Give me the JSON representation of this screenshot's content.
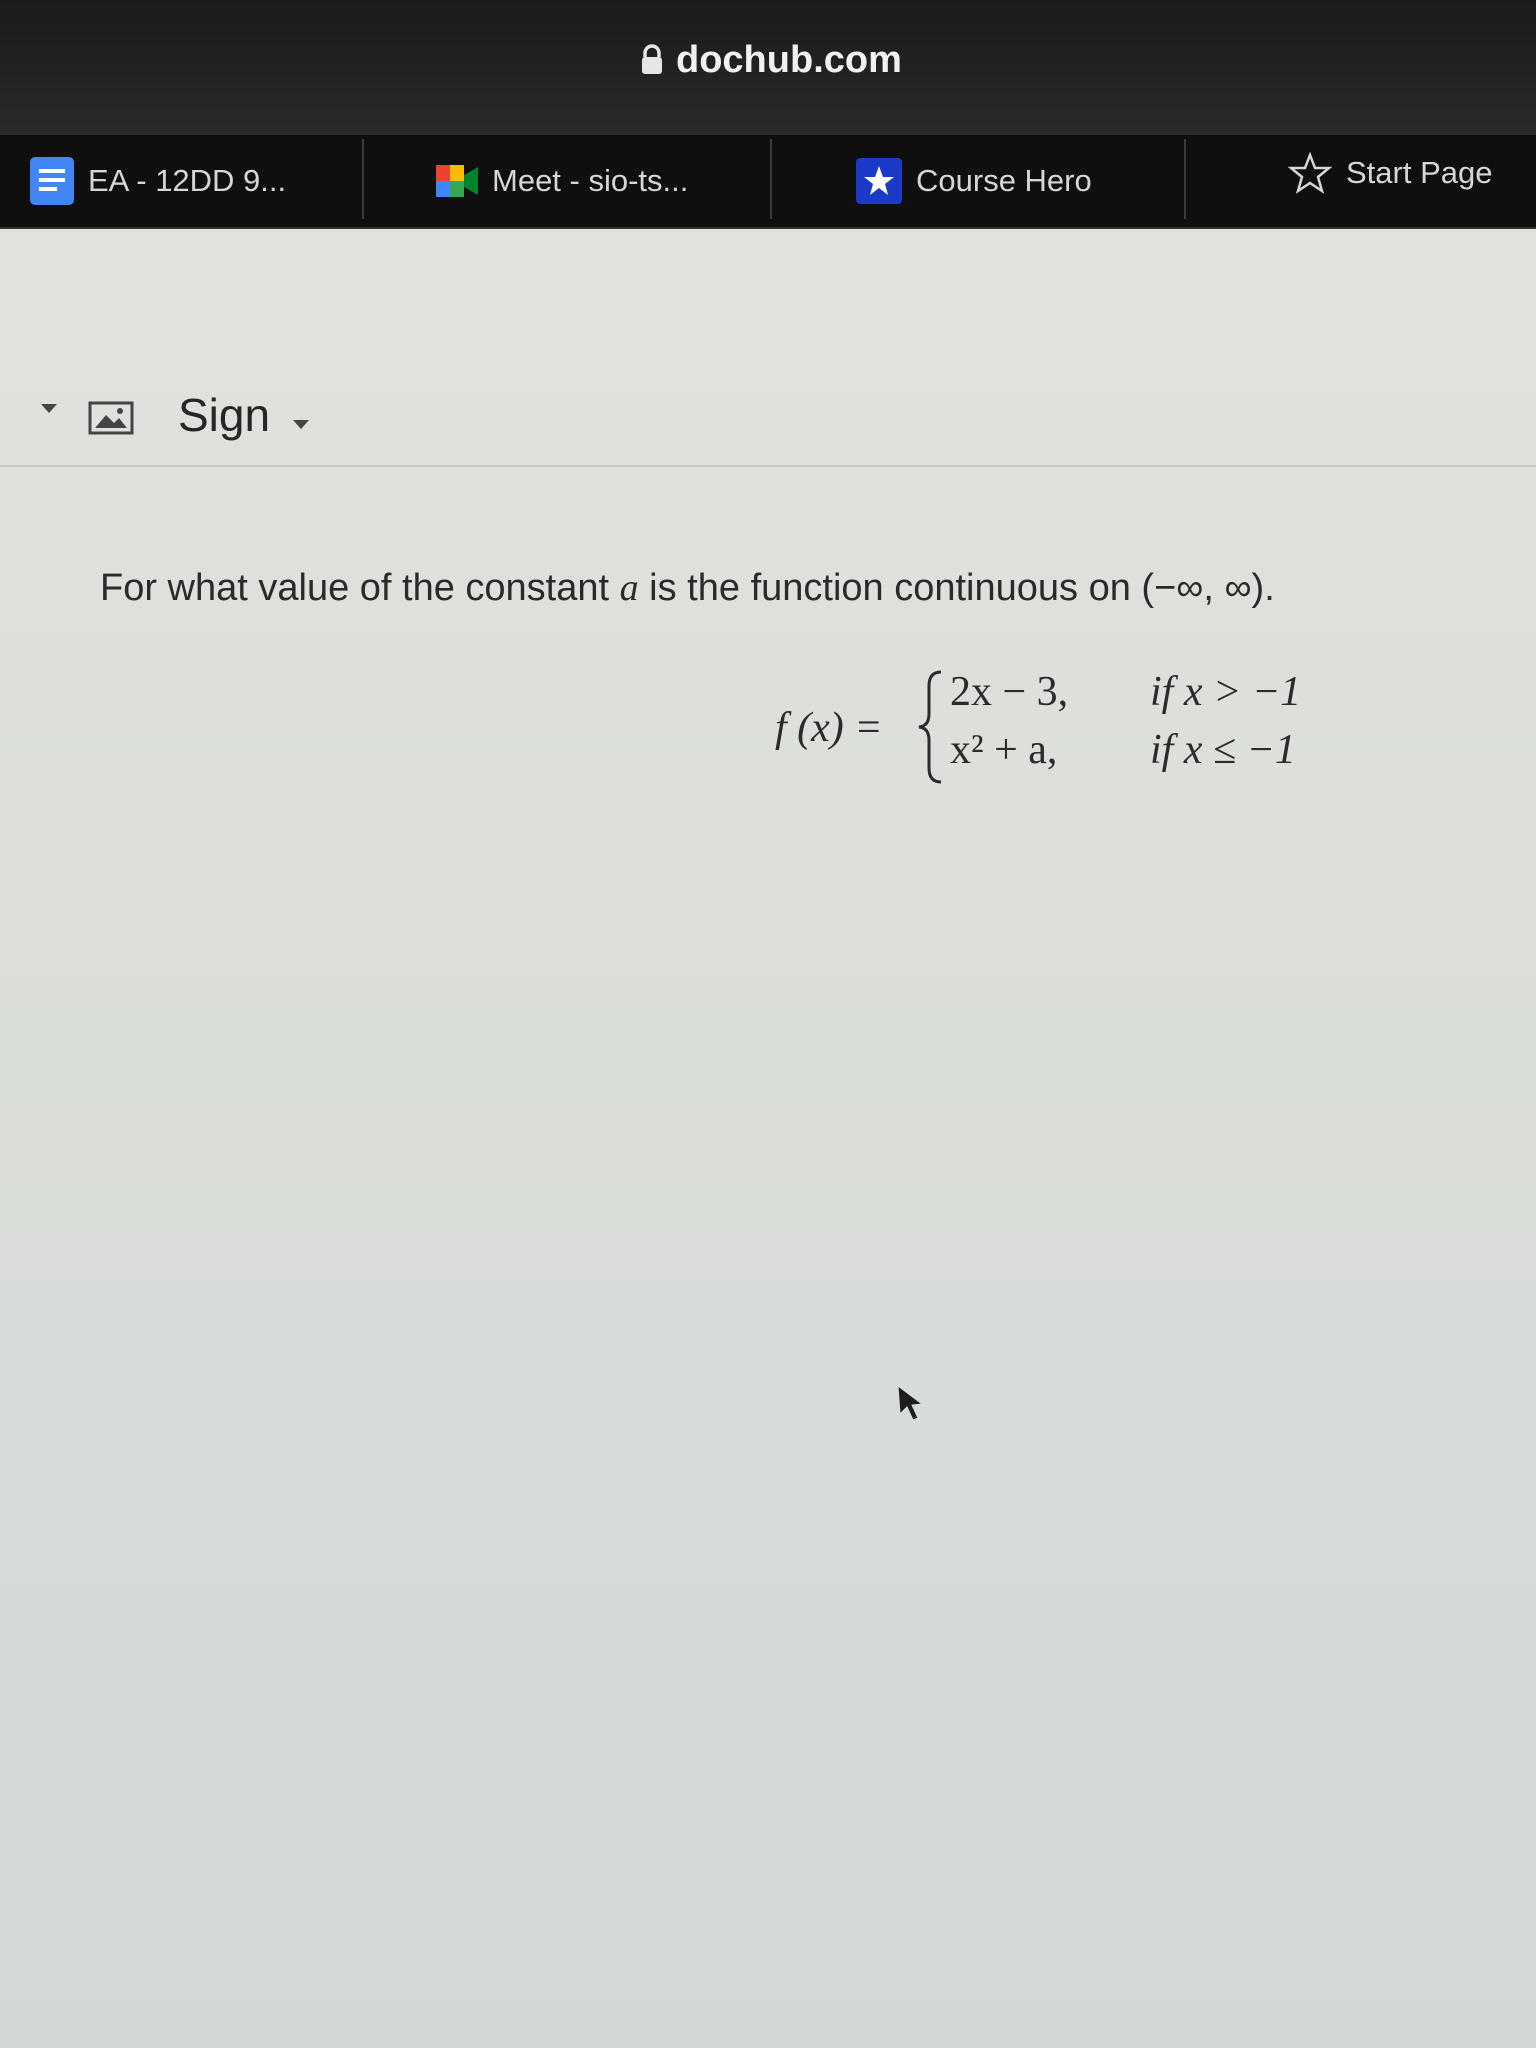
{
  "browser": {
    "url": "dochub.com",
    "bookmarks": [
      {
        "label": "EA - 12DD 9...",
        "icon": "docs-icon"
      },
      {
        "label": "Meet - sio-ts...",
        "icon": "meet-icon"
      },
      {
        "label": "Course Hero",
        "icon": "star-filled-icon"
      },
      {
        "label": "Start Page",
        "icon": "star-outline-icon"
      }
    ]
  },
  "toolbar": {
    "sign_label": "Sign"
  },
  "document": {
    "question_prefix": "For what value of the constant ",
    "question_var": "a",
    "question_suffix": " is the function continuous on (−∞, ∞).",
    "function_lhs": "f (x) =",
    "pieces": [
      {
        "expression": "2x − 3,",
        "condition": "if x > −1"
      },
      {
        "expression": "x² + a,",
        "condition": "if x ≤ −1"
      }
    ]
  },
  "colors": {
    "address_bar": "#1b1b1b",
    "bookmarks_bar": "#0f0f10",
    "page_background": "#dcdfd9",
    "text": "#2a2a2a"
  }
}
